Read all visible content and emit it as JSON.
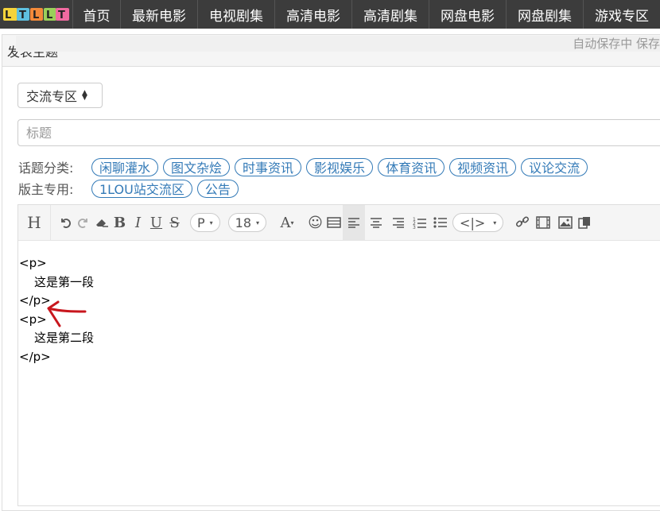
{
  "nav": {
    "logo_text": "LTLLT",
    "items": [
      "首页",
      "最新电影",
      "电视剧集",
      "高清电影",
      "高清剧集",
      "网盘电影",
      "网盘剧集",
      "游戏专区"
    ]
  },
  "panel": {
    "title": "发表主题"
  },
  "form": {
    "section_select": "交流专区",
    "title_placeholder": "标题",
    "topic_label": "话题分类:",
    "topic_tags": [
      "闲聊灌水",
      "图文杂烩",
      "时事资讯",
      "影视娱乐",
      "体育资讯",
      "视频资讯",
      "议论交流"
    ],
    "admin_label": "版主专用:",
    "admin_tags": [
      "1LOU站交流区",
      "公告"
    ]
  },
  "toolbar": {
    "heading": "H",
    "paragraph": "P",
    "font_size": "18",
    "font_color": "A",
    "code_block": "<|>"
  },
  "editor": {
    "autosave_text": "自动保存中 保存",
    "lines": [
      "<p>",
      "这是第一段",
      "</p>",
      "<p>",
      "这是第二段",
      "</p>"
    ]
  },
  "colors": {
    "nav_bg": "#3c3c3c",
    "tag_blue": "#337ab7",
    "annotation_red": "#c8161d"
  }
}
